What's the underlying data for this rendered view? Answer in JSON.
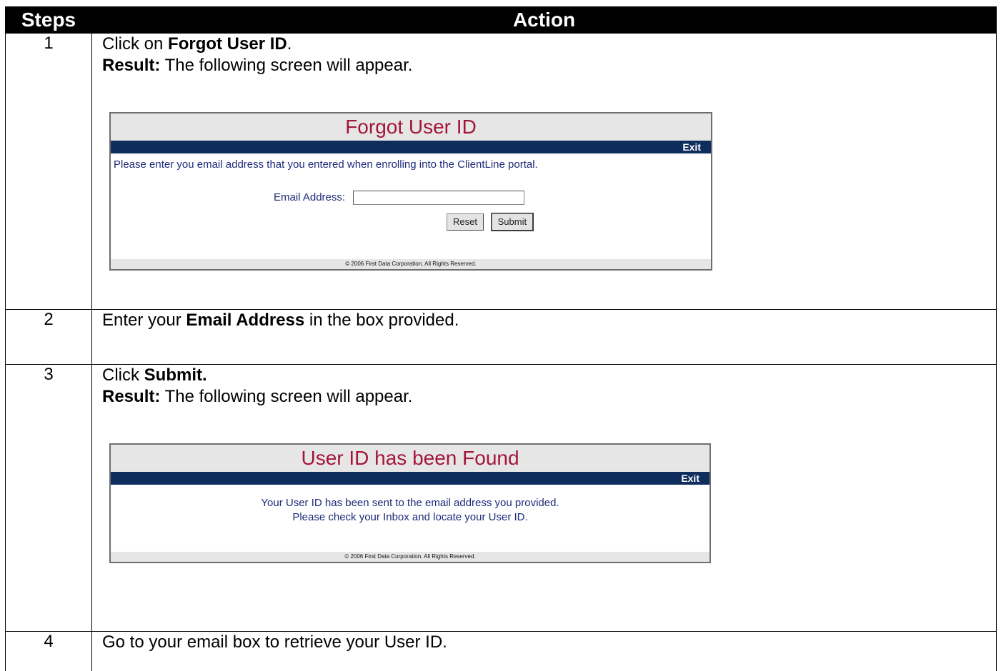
{
  "table": {
    "header_steps": "Steps",
    "header_action": "Action"
  },
  "steps": [
    {
      "num": "1",
      "pre": "Click on ",
      "bold": "Forgot User ID",
      "post": ".",
      "result_label": "Result:",
      "result_text": " The following screen will appear."
    },
    {
      "num": "2",
      "pre": "Enter your ",
      "bold": "Email Address",
      "post": " in the box provided."
    },
    {
      "num": "3",
      "pre": "Click ",
      "bold": "Submit.",
      "post": "",
      "result_label": "Result:",
      "result_text": " The following screen will appear."
    },
    {
      "num": "4",
      "text": "Go to your email box to retrieve your User ID."
    }
  ],
  "forgot_panel": {
    "title": "Forgot User ID",
    "exit": "Exit",
    "message": "Please enter you email address that you entered when enrolling into the ClientLine portal.",
    "email_label": "Email Address:",
    "email_value": "",
    "reset_label": "Reset",
    "submit_label": "Submit",
    "footer": "© 2006 First Data Corporation. All Rights Reserved."
  },
  "found_panel": {
    "title": "User ID has been Found",
    "exit": "Exit",
    "line1": "Your User ID has been sent to the email address you provided.",
    "line2": "Please check your Inbox and locate your User ID.",
    "footer": "© 2006 First Data Corporation. All Rights Reserved."
  },
  "colors": {
    "header_bg": "#000000",
    "panel_title": "#a4153a",
    "panel_bar": "#0e2d5c",
    "panel_text": "#1d2a78"
  }
}
